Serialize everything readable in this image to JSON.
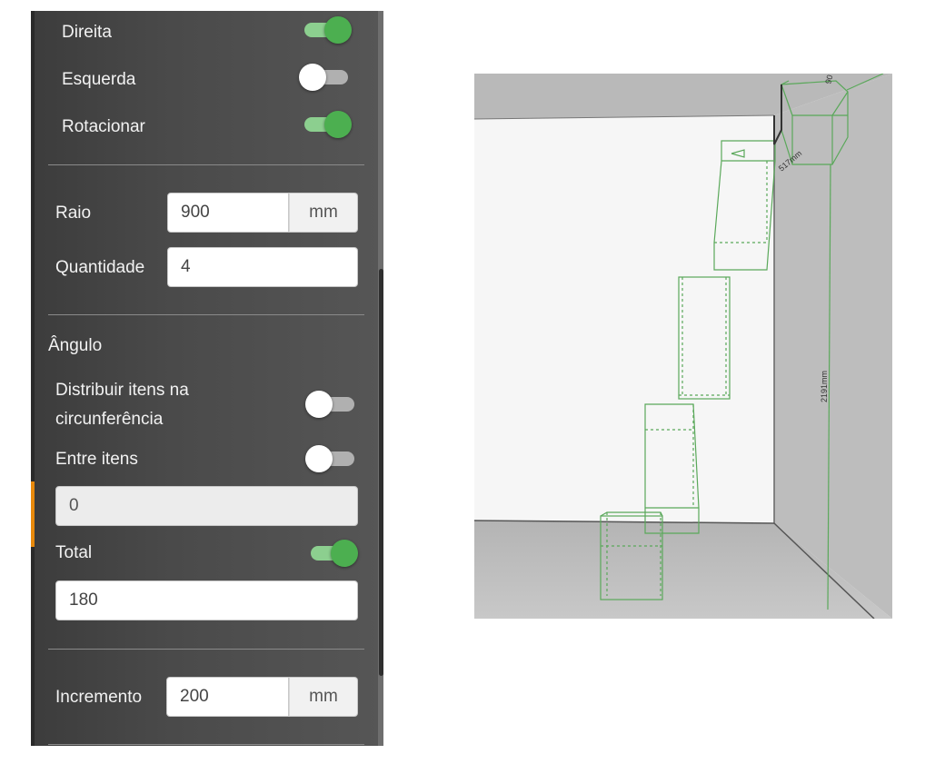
{
  "toggles_top": [
    {
      "label": "Direita",
      "on": true
    },
    {
      "label": "Esquerda",
      "on": false
    },
    {
      "label": "Rotacionar",
      "on": true
    }
  ],
  "raio": {
    "label": "Raio",
    "value": "900",
    "unit": "mm"
  },
  "quantidade": {
    "label": "Quantidade",
    "value": "4"
  },
  "angulo": {
    "heading": "Ângulo",
    "distribuir": {
      "label_line1": "Distribuir itens na",
      "label_line2": "circunferência",
      "on": false
    },
    "entre_itens": {
      "label": "Entre itens",
      "on": false,
      "value": "0"
    },
    "total": {
      "label": "Total",
      "on": true,
      "value": "180"
    }
  },
  "incremento": {
    "label": "Incremento",
    "value": "200",
    "unit": "mm"
  },
  "viewport": {
    "dimension_width": "517mm",
    "dimension_height": "2191mm",
    "dimension_top": "90"
  },
  "colors": {
    "toggle_on": "#4caf50",
    "accent": "#e8890c",
    "wireframe": "#5aa85a"
  }
}
